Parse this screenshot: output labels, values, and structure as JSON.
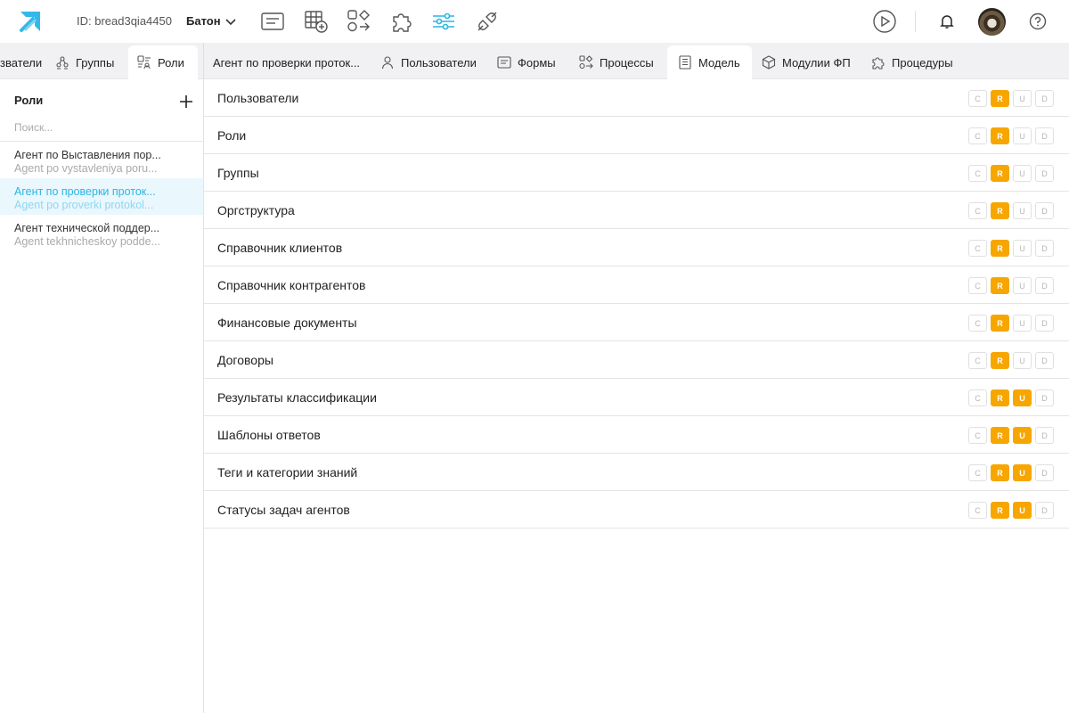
{
  "header": {
    "app_id": "ID: bread3qia4450",
    "workspace": "Батон"
  },
  "tabs_left": [
    {
      "label": "зватели",
      "icon": "users-icon"
    },
    {
      "label": "Группы",
      "icon": "group-icon"
    },
    {
      "label": "Роли",
      "icon": "roles-icon",
      "active": true
    }
  ],
  "tabs_main": [
    {
      "label": "Агент по проверки проток...",
      "icon": ""
    },
    {
      "label": "Пользователи",
      "icon": "user-icon"
    },
    {
      "label": "Формы",
      "icon": "form-icon"
    },
    {
      "label": "Процессы",
      "icon": "process-icon"
    },
    {
      "label": "Модель",
      "icon": "model-icon",
      "active": true
    },
    {
      "label": "Модулии ФП",
      "icon": "module-icon"
    },
    {
      "label": "Процедуры",
      "icon": "puzzle-icon"
    }
  ],
  "sidebar": {
    "title": "Роли",
    "search_placeholder": "Поиск...",
    "roles": [
      {
        "name": "Агент по Выставления пор...",
        "sub": "Agent po vystavleniya poru...",
        "selected": false
      },
      {
        "name": "Агент по проверки проток...",
        "sub": "Agent po proverki protokol...",
        "selected": true
      },
      {
        "name": "Агент технической поддер...",
        "sub": "Agent tekhnicheskoy podde...",
        "selected": false
      }
    ]
  },
  "permission_labels": [
    "C",
    "R",
    "U",
    "D"
  ],
  "accent_color": "#f7a600",
  "selection_color": "#29b6e6",
  "entities": [
    {
      "name": "Пользователи",
      "perms": [
        false,
        true,
        false,
        false
      ]
    },
    {
      "name": "Роли",
      "perms": [
        false,
        true,
        false,
        false
      ]
    },
    {
      "name": "Группы",
      "perms": [
        false,
        true,
        false,
        false
      ]
    },
    {
      "name": "Оргструктура",
      "perms": [
        false,
        true,
        false,
        false
      ]
    },
    {
      "name": "Справочник клиентов",
      "perms": [
        false,
        true,
        false,
        false
      ]
    },
    {
      "name": "Справочник контрагентов",
      "perms": [
        false,
        true,
        false,
        false
      ]
    },
    {
      "name": "Финансовые документы",
      "perms": [
        false,
        true,
        false,
        false
      ]
    },
    {
      "name": "Договоры",
      "perms": [
        false,
        true,
        false,
        false
      ]
    },
    {
      "name": "Результаты классификации",
      "perms": [
        false,
        true,
        true,
        false
      ]
    },
    {
      "name": "Шаблоны ответов",
      "perms": [
        false,
        true,
        true,
        false
      ]
    },
    {
      "name": "Теги и категории знаний",
      "perms": [
        false,
        true,
        true,
        false
      ]
    },
    {
      "name": "Статусы задач агентов",
      "perms": [
        false,
        true,
        true,
        false
      ]
    }
  ]
}
